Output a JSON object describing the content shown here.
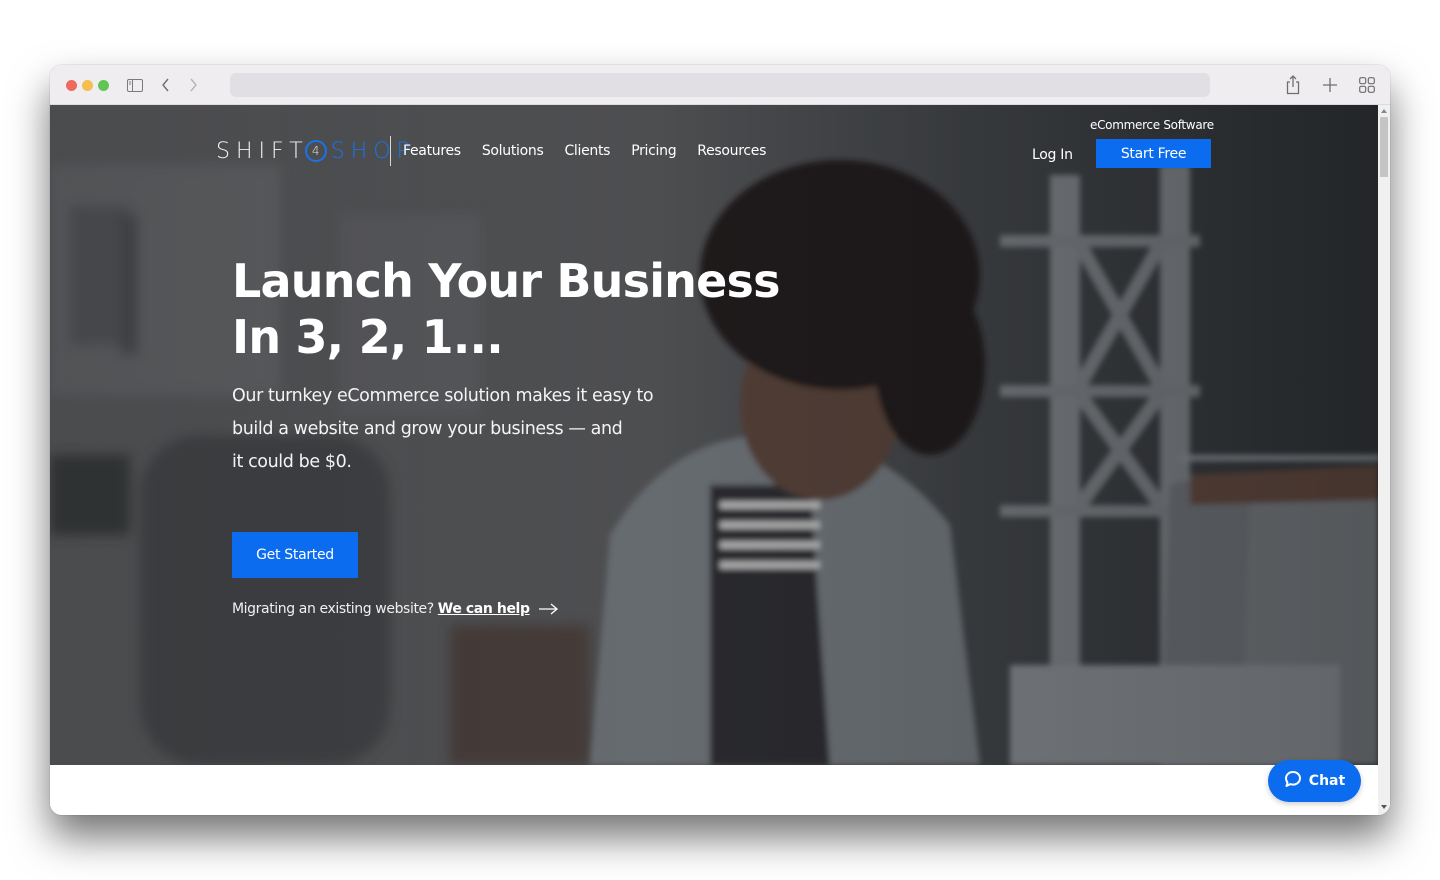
{
  "browser": {
    "url_bar": {
      "value": "",
      "placeholder": ""
    },
    "icons": {
      "sidebar": "sidebar-icon",
      "back": "chevron-left-icon",
      "forward": "chevron-right-icon",
      "share": "share-icon",
      "new_tab": "plus-icon",
      "tab_overview": "grid-icon"
    }
  },
  "site": {
    "logo": {
      "part1": "SHIFT",
      "number": "4",
      "part2": "SHOP"
    },
    "nav": {
      "links": [
        {
          "label": "Features"
        },
        {
          "label": "Solutions"
        },
        {
          "label": "Clients"
        },
        {
          "label": "Pricing"
        },
        {
          "label": "Resources"
        }
      ],
      "tagline": "eCommerce Software",
      "login_label": "Log In",
      "cta_label": "Start Free"
    },
    "hero": {
      "headline_line1": "Launch Your Business",
      "headline_line2": "In 3, 2, 1...",
      "subcopy_line1": "Our turnkey eCommerce solution makes it easy to",
      "subcopy_line2": "build a website and grow your business — and",
      "subcopy_line3": "it could be $0.",
      "cta_label": "Get Started",
      "migrate_text": "Migrating an existing website?",
      "migrate_link": "We can help"
    },
    "chat": {
      "label": "Chat",
      "icon": "chat-bubble-icon"
    },
    "colors": {
      "brand_blue": "#0b6cf0",
      "logo_blue": "#1a73e8",
      "hero_overlay": "#4a4b4d"
    }
  }
}
